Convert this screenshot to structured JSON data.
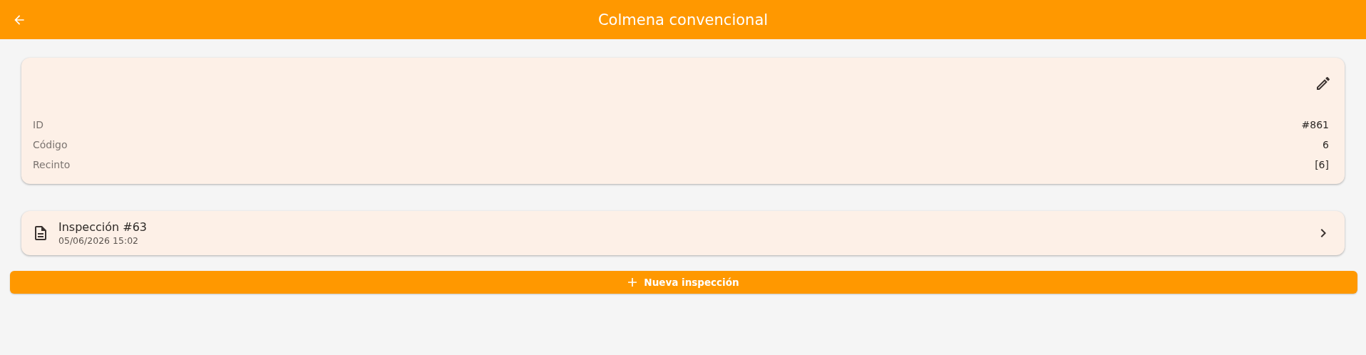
{
  "app_bar": {
    "title": "Colmena convencional"
  },
  "details": {
    "fields": [
      {
        "label": "ID",
        "value": "#861"
      },
      {
        "label": "Código",
        "value": "6"
      },
      {
        "label": "Recinto",
        "value": "[6]"
      }
    ]
  },
  "inspections": [
    {
      "title": "Inspección #63",
      "date": "05/06/2026 15:02"
    }
  ],
  "new_button": {
    "label": "Nueva inspección"
  }
}
